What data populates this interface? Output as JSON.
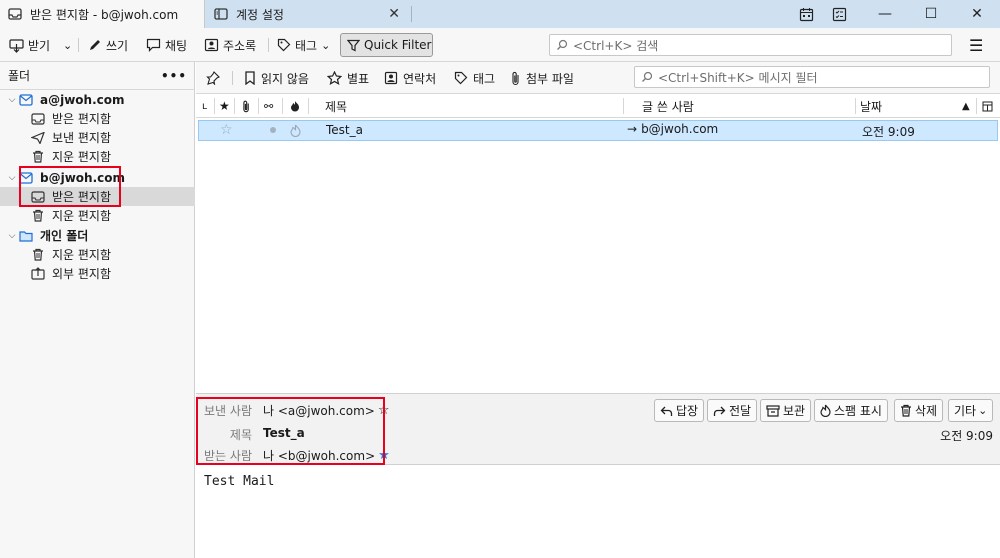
{
  "tabs": [
    {
      "label": "받은 편지함 - b@jwoh.com",
      "icon": "inbox-icon"
    },
    {
      "label": "계정 설정",
      "icon": "settings-tab-icon"
    }
  ],
  "toolbar": {
    "get_label": "받기",
    "write_label": "쓰기",
    "chat_label": "채팅",
    "addressbook_label": "주소록",
    "tag_label": "태그",
    "quickfilter_label": "Quick Filter",
    "search_placeholder": "<Ctrl+K> 검색"
  },
  "folders": {
    "header": "폴더",
    "more": "•••",
    "items": [
      {
        "label": "a@jwoh.com",
        "type": "account"
      },
      {
        "label": "받은 편지함",
        "type": "inbox"
      },
      {
        "label": "보낸 편지함",
        "type": "sent"
      },
      {
        "label": "지운 편지함",
        "type": "trash"
      },
      {
        "label": "b@jwoh.com",
        "type": "account"
      },
      {
        "label": "받은 편지함",
        "type": "inbox"
      },
      {
        "label": "지운 편지함",
        "type": "trash"
      },
      {
        "label": "개인 폴더",
        "type": "local"
      },
      {
        "label": "지운 편지함",
        "type": "trash"
      },
      {
        "label": "외부 편지함",
        "type": "outbox"
      }
    ]
  },
  "msgtoolbar": {
    "unread_label": "읽지 않음",
    "starred_label": "별표",
    "contact_label": "연락처",
    "tag_label": "태그",
    "attachment_label": "첨부 파일",
    "filter_placeholder": "<Ctrl+Shift+K> 메시지 필터"
  },
  "columns": {
    "subject": "제목",
    "author": "글 쓴 사람",
    "date": "날짜"
  },
  "messages": [
    {
      "subject": "Test_a",
      "correspondent": "b@jwoh.com",
      "date": "오전 9:09"
    }
  ],
  "header": {
    "from_label": "보낸 사람",
    "from_value": "나 <a@jwoh.com>",
    "subject_label": "제목",
    "subject_value": "Test_a",
    "to_label": "받는 사람",
    "to_value": "나 <b@jwoh.com>",
    "date": "오전 9:09",
    "reply_label": "답장",
    "forward_label": "전달",
    "archive_label": "보관",
    "junk_label": "스팸 표시",
    "delete_label": "삭제",
    "other_label": "기타"
  },
  "body_text": "Test Mail",
  "colors": {
    "titlebar": "#cfe0f0",
    "selection": "#cde8ff",
    "highlight_box": "#e8001c",
    "star_blue": "#1a73e8"
  }
}
